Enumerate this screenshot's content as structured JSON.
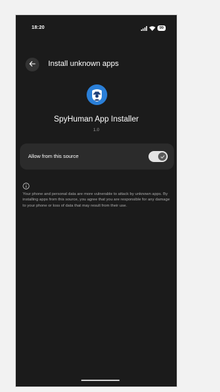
{
  "status_bar": {
    "time": "18:20",
    "battery": "99"
  },
  "header": {
    "title": "Install unknown apps"
  },
  "app": {
    "name": "SpyHuman App Installer",
    "version": "1.0",
    "icon": "spy-agent-icon"
  },
  "setting": {
    "label": "Allow from this source",
    "enabled": true
  },
  "warning": {
    "icon": "info-icon",
    "text": "Your phone and personal data are more vulnerable to attack by unknown apps. By installing apps from this source, you agree that you are responsible for any damage to your phone or loss of data that may result from their use."
  },
  "colors": {
    "background": "#1b1b1b",
    "surface": "#2b2b2b",
    "app_icon": "#2a7fd8",
    "toggle_track": "#e4e4e4"
  }
}
